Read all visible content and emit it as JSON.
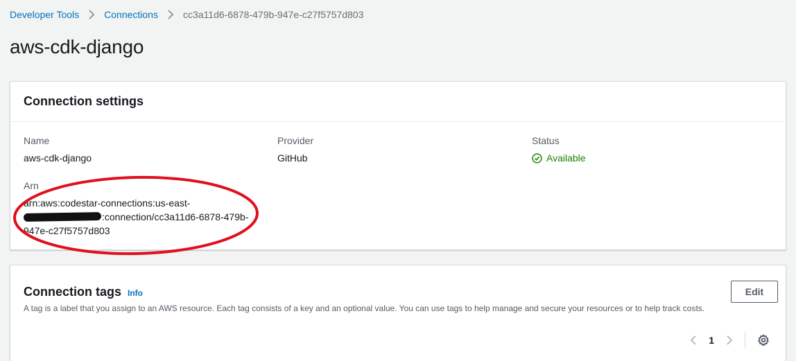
{
  "breadcrumb": {
    "items": [
      "Developer Tools",
      "Connections"
    ],
    "current": "cc3a11d6-6878-479b-947e-c27f5757d803"
  },
  "page": {
    "title": "aws-cdk-django"
  },
  "settings": {
    "title": "Connection settings",
    "name": {
      "label": "Name",
      "value": "aws-cdk-django"
    },
    "provider": {
      "label": "Provider",
      "value": "GitHub"
    },
    "status": {
      "label": "Status",
      "value": "Available",
      "color": "#1d8102",
      "icon": "check-circle-icon"
    },
    "arn": {
      "label": "Arn",
      "line1": "arn:aws:codestar-connections:us-east-",
      "line2": ":connection/cc3a11d6-6878-479b-",
      "line3": "947e-c27f5757d803"
    }
  },
  "tags": {
    "title": "Connection tags",
    "info": "Info",
    "description": "A tag is a label that you assign to an AWS resource. Each tag consists of a key and an optional value. You can use tags to help manage and secure your resources or to help track costs.",
    "edit_label": "Edit",
    "page_number": "1"
  },
  "colors": {
    "link": "#0073bb",
    "annotation": "#e0101c",
    "success": "#1d8102"
  }
}
